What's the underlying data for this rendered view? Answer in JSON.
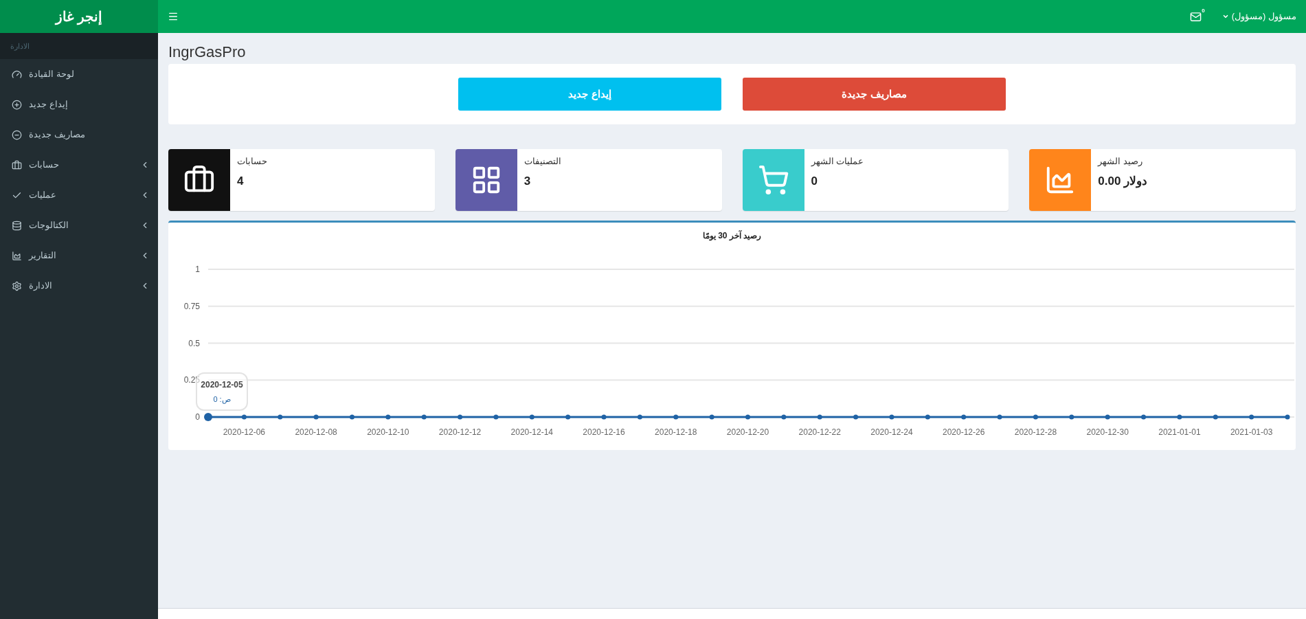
{
  "brand": "إنجر غاز",
  "topbar": {
    "mail_count": "0",
    "user": "مسؤول (مسؤول)"
  },
  "sidebar": {
    "header": "الادارة",
    "items": [
      {
        "label": "لوحة القيادة",
        "kind": "link"
      },
      {
        "label": "إيداع جديد",
        "kind": "link"
      },
      {
        "label": "مصاريف جديدة",
        "kind": "link"
      },
      {
        "label": "حسابات",
        "kind": "tree"
      },
      {
        "label": "عمليات",
        "kind": "tree"
      },
      {
        "label": "الكتالوجات",
        "kind": "tree"
      },
      {
        "label": "التقارير",
        "kind": "tree"
      },
      {
        "label": "الادارة",
        "kind": "tree"
      }
    ]
  },
  "page_title": "IngrGasPro",
  "actions": [
    {
      "label": "مصاريف جديدة",
      "color": "#dd4b39"
    },
    {
      "label": "إيداع جديد",
      "color": "#00c0ef"
    }
  ],
  "info_boxes": [
    {
      "label": "رصيد الشهر",
      "value": "دولار 0.00",
      "color": "#ff851b"
    },
    {
      "label": "عمليات الشهر",
      "value": "0",
      "color": "#39cccc"
    },
    {
      "label": "التصنيفات",
      "value": "3",
      "color": "#605ca8"
    },
    {
      "label": "حسابات",
      "value": "4",
      "color": "#111111"
    }
  ],
  "balance_chart": {
    "tooltip": {
      "title": "2020-12-05",
      "text": "ص: 0"
    },
    "chart_data": {
      "type": "line",
      "title": "رصيد آخر 30 يومًا",
      "categories": [
        null,
        "2020-12-06",
        null,
        "2020-12-08",
        null,
        "2020-12-10",
        null,
        "2020-12-12",
        null,
        "2020-12-14",
        null,
        "2020-12-16",
        null,
        "2020-12-18",
        null,
        "2020-12-20",
        null,
        "2020-12-22",
        null,
        "2020-12-24",
        null,
        "2020-12-26",
        null,
        "2020-12-28",
        null,
        "2020-12-30",
        null,
        "2021-01-01",
        null,
        "2021-01-03",
        null
      ],
      "grid": true,
      "series": [
        {
          "color": "#1f62a5",
          "marker": true,
          "values": [
            0,
            0,
            0,
            0,
            0,
            0,
            0,
            0,
            0,
            0,
            0,
            0,
            0,
            0,
            0,
            0,
            0,
            0,
            0,
            0,
            0,
            0,
            0,
            0,
            0,
            0,
            0,
            0,
            0,
            0,
            0
          ]
        }
      ],
      "ylim": [
        0,
        1
      ],
      "yticks": [
        0,
        0.25,
        0.5,
        0.75,
        1
      ]
    }
  }
}
